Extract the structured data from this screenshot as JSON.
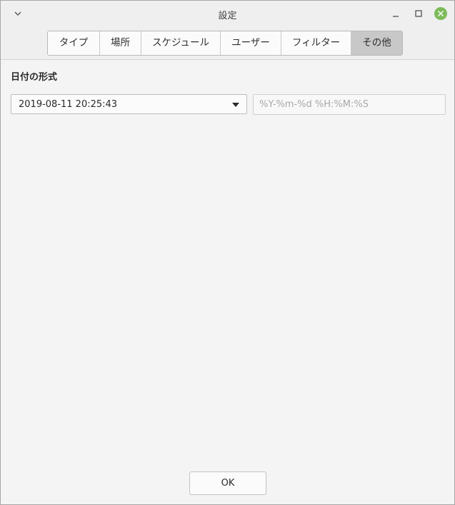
{
  "window": {
    "title": "設定"
  },
  "titlebar_icons": {
    "menu": "chevron-down-icon",
    "minimize": "minimize-icon",
    "maximize": "maximize-icon",
    "close": "close-icon",
    "close_color": "#7dbb5a"
  },
  "tabs": [
    {
      "label": "タイプ",
      "active": false
    },
    {
      "label": "場所",
      "active": false
    },
    {
      "label": "スケジュール",
      "active": false
    },
    {
      "label": "ユーザー",
      "active": false
    },
    {
      "label": "フィルター",
      "active": false
    },
    {
      "label": "その他",
      "active": true
    }
  ],
  "date_format": {
    "label": "日付の形式",
    "selected_value": "2019-08-11 20:25:43",
    "custom_placeholder": "%Y-%m-%d %H:%M:%S"
  },
  "footer": {
    "ok_label": "OK"
  }
}
